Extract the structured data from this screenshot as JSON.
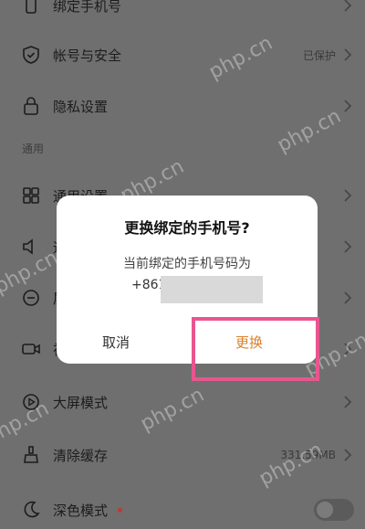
{
  "settings": {
    "top_partial_label": "绑定手机号",
    "account": {
      "label": "帐号与安全",
      "value": "已保护"
    },
    "privacy": {
      "label": "隐私设置"
    },
    "section_general": "通用",
    "general_settings": {
      "label": "通用设置"
    },
    "row_partial_1": {
      "label": "通"
    },
    "row_partial_2": {
      "label": "屏"
    },
    "row_partial_3": {
      "label": "视"
    },
    "big_screen": {
      "label": "大屏模式"
    },
    "clear_cache": {
      "label": "清除缓存",
      "value": "331.59MB"
    },
    "dark_mode": {
      "label": "深色模式",
      "enabled": false
    }
  },
  "dialog": {
    "title": "更换绑定的手机号?",
    "message": "当前绑定的手机号码为",
    "phone_prefix": "+861",
    "cancel_label": "取消",
    "confirm_label": "更换"
  },
  "watermark": "php.cn",
  "colors": {
    "accent": "#d9822b",
    "highlight": "#e9558f"
  }
}
